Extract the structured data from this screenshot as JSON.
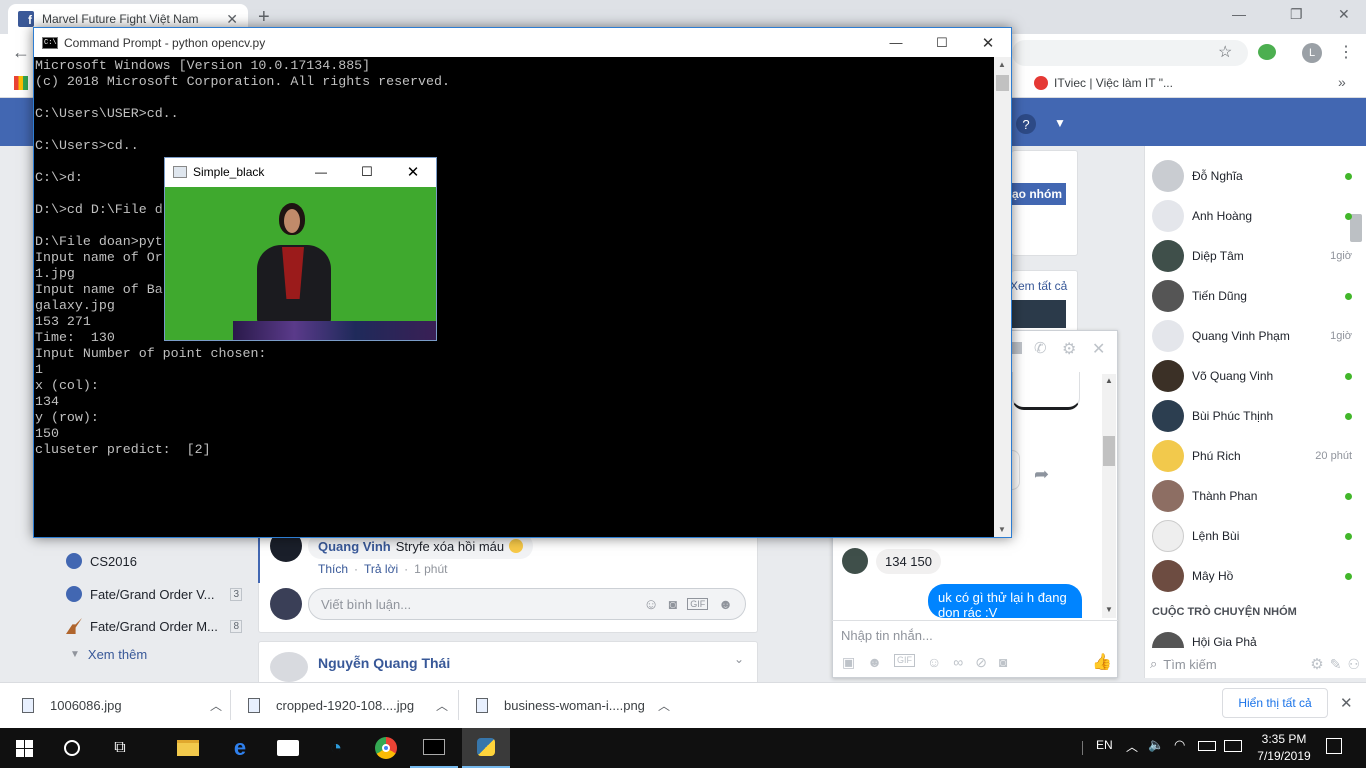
{
  "browser": {
    "tab_title": "Marvel Future Fight Việt Nam",
    "bookmark": "ITviec | Việc làm IT \"..."
  },
  "cmd": {
    "title": "Command Prompt - python  opencv.py",
    "lines": [
      "Microsoft Windows [Version 10.0.17134.885]",
      "(c) 2018 Microsoft Corporation. All rights reserved.",
      "",
      "C:\\Users\\USER>cd..",
      "",
      "C:\\Users>cd..",
      "",
      "C:\\>d:",
      "",
      "D:\\>cd D:\\File d",
      "",
      "D:\\File doan>pyt",
      "Input name of Or",
      "1.jpg",
      "Input name of Ba",
      "galaxy.jpg",
      "153 271",
      "Time:  130",
      "Input Number of point chosen:",
      "1",
      "x (col):",
      "134",
      "y (row):",
      "150",
      "cluseter predict:  [2]"
    ]
  },
  "opencv_window": {
    "title": "Simple_black"
  },
  "feed": {
    "create_group_btn": "ạo nhóm",
    "see_all": "Xem tất cả",
    "left_nav": [
      {
        "label": "CS2016",
        "count": ""
      },
      {
        "label": "Fate/Grand Order V...",
        "count": "3"
      },
      {
        "label": "Fate/Grand Order M...",
        "count": "8"
      }
    ],
    "see_more": "Xem thêm",
    "comment_author": "Quang Vinh",
    "comment_text": "Stryfe xóa hồi máu",
    "comment_like": "Thích",
    "comment_reply": "Trả lời",
    "comment_time": "1 phút",
    "comment_placeholder": "Viết bình luận...",
    "next_post_author": "Nguyễn Quang Thái"
  },
  "messenger": {
    "received": "134 150",
    "sent": "uk có gì thử lại h đang dọn rác :V",
    "input_placeholder": "Nhập tin nhắn..."
  },
  "chat_sidebar": {
    "contacts": [
      {
        "name": "Đỗ Nghĩa",
        "status": "online",
        "time": ""
      },
      {
        "name": "Anh Hoàng",
        "status": "online",
        "time": ""
      },
      {
        "name": "Diệp Tâm",
        "status": "away",
        "time": "1giờ"
      },
      {
        "name": "Tiến Dũng",
        "status": "online",
        "time": ""
      },
      {
        "name": "Quang Vinh Phạm",
        "status": "away",
        "time": "1giờ"
      },
      {
        "name": "Võ Quang Vinh",
        "status": "online",
        "time": ""
      },
      {
        "name": "Bùi Phúc Thịnh",
        "status": "online",
        "time": ""
      },
      {
        "name": "Phú Rich",
        "status": "away",
        "time": "20 phút"
      },
      {
        "name": "Thành Phan",
        "status": "online",
        "time": ""
      },
      {
        "name": "Lệnh Bùi",
        "status": "online",
        "time": ""
      },
      {
        "name": "Mây Hồ",
        "status": "online",
        "time": ""
      }
    ],
    "group_heading": "CUỘC TRÒ CHUYỆN NHÓM",
    "group_first": "Hội Gia Phả",
    "search_placeholder": "Tìm kiếm"
  },
  "downloads": {
    "files": [
      "1006086.jpg",
      "cropped-1920-108....jpg",
      "business-woman-i....png"
    ],
    "show_all": "Hiển thị tất cả"
  },
  "taskbar": {
    "lang": "EN",
    "time": "3:35 PM",
    "date": "7/19/2019"
  },
  "colors": {
    "facebook_blue": "#4267b2",
    "online_green": "#42b72a",
    "messenger_blue": "#0084ff",
    "green_screen": "#3fa92e"
  }
}
